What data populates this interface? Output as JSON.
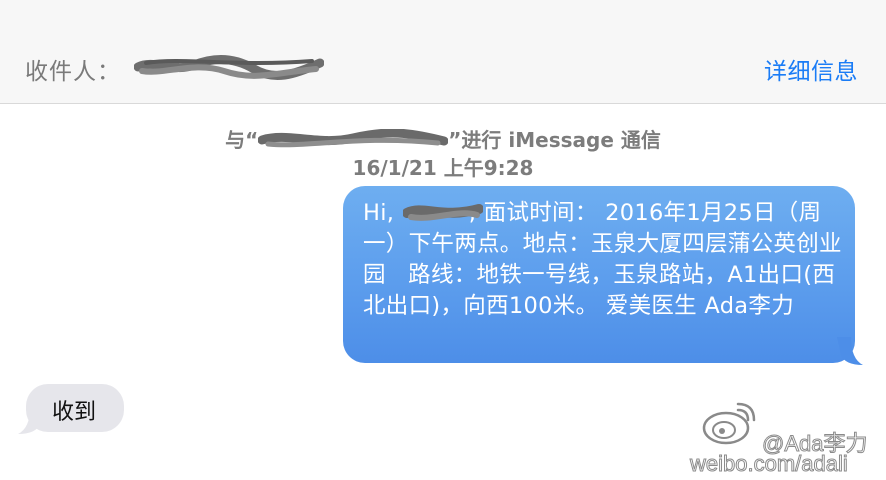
{
  "header": {
    "to_label": "收件人：",
    "details_label": "详细信息"
  },
  "conversation": {
    "service_prefix": "与“",
    "service_suffix": "”进行 iMessage 通信",
    "timestamp": "16/1/21 上午9:28"
  },
  "messages": {
    "outgoing": {
      "text": "Hi,          , 面试时间： 2016年1月25日（周一）下午两点。地点：玉泉大厦四层蒲公英创业园   路线：地铁一号线，玉泉路站，A1出口(西北出口)，向西100米。 爱美医生 Ada李力"
    },
    "incoming": {
      "text": "收到"
    }
  },
  "watermark": {
    "handle": "@Ada李力",
    "url": "weibo.com/adali"
  },
  "colors": {
    "accent": "#1a7cf6",
    "outgoing_bubble": "#5c9ded",
    "incoming_bubble": "#e6e6eb",
    "header_bg": "#f7f7f7"
  }
}
